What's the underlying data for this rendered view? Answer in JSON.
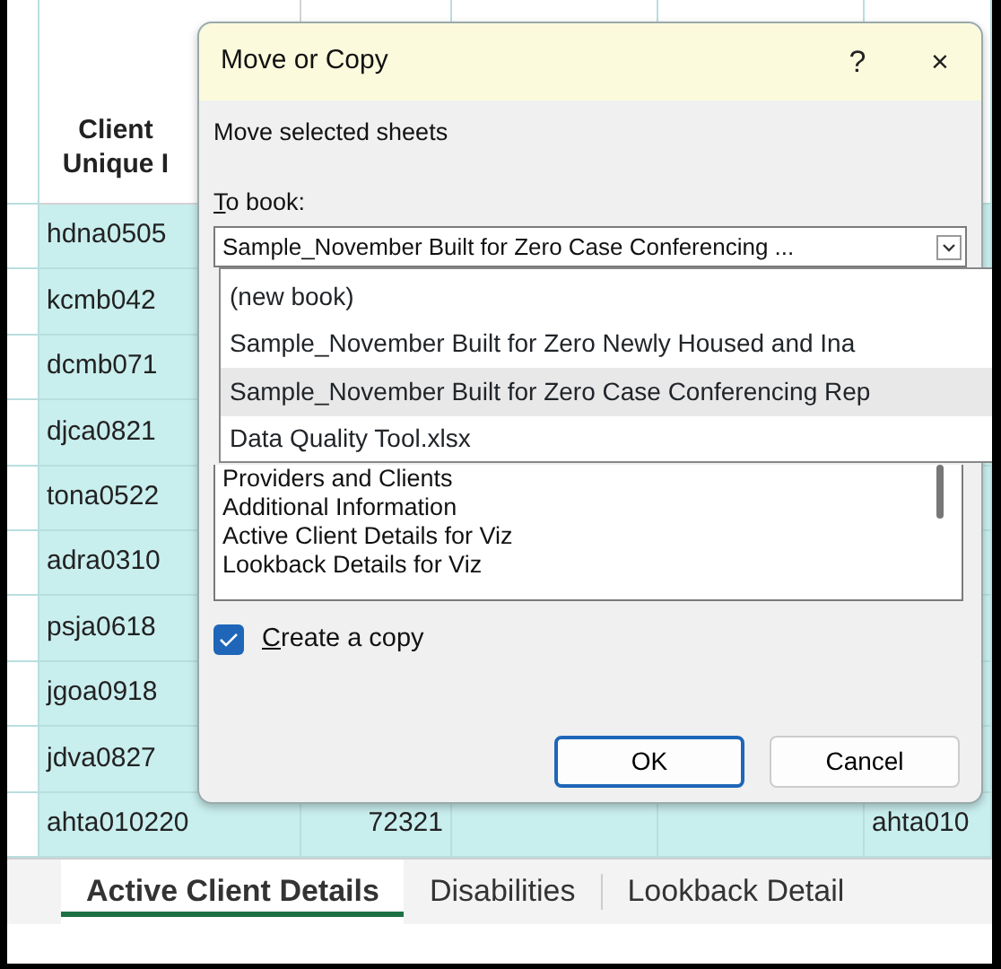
{
  "sheet": {
    "header_lines": [
      "Client",
      "Unique I"
    ],
    "rows": [
      {
        "client_id": "hdna0505"
      },
      {
        "client_id": "kcmb042"
      },
      {
        "client_id": "dcmb071"
      },
      {
        "client_id": "djca0821"
      },
      {
        "client_id": "tona0522"
      },
      {
        "client_id": "adra0310"
      },
      {
        "client_id": "psja0618"
      },
      {
        "client_id": "jgoa0918"
      },
      {
        "client_id": "jdva0827"
      },
      {
        "client_id": "ahta010220",
        "column_3": "72321",
        "column_6": "ahta010"
      }
    ]
  },
  "sheet_tabs": [
    {
      "label": "Active Client Details",
      "selected": true
    },
    {
      "label": "Disabilities",
      "selected": false
    },
    {
      "label": "Lookback Detail",
      "selected": false
    }
  ],
  "dialog": {
    "title": "Move or Copy",
    "help": "?",
    "close": "×",
    "prompt": "Move selected sheets",
    "to_book": {
      "mnemonic": "T",
      "rest": "o book:"
    },
    "combo_value": "Sample_November Built for Zero Case Conferencing ...",
    "book_options": [
      {
        "label": "(new book)",
        "selected": false
      },
      {
        "label": "Sample_November Built for Zero Newly Housed and Ina",
        "selected": false
      },
      {
        "label": "Sample_November Built for Zero Case Conferencing Rep",
        "selected": true
      },
      {
        "label": "Data Quality Tool.xlsx",
        "selected": false
      }
    ],
    "sheets": [
      "Providers and Clients",
      "Additional Information",
      "Active Client Details for Viz",
      "Lookback Details for Viz"
    ],
    "create_copy": {
      "mnemonic": "C",
      "rest": "reate a copy",
      "checked": true
    },
    "buttons": [
      {
        "label": "OK",
        "default": true
      },
      {
        "label": "Cancel",
        "default": false
      }
    ]
  }
}
